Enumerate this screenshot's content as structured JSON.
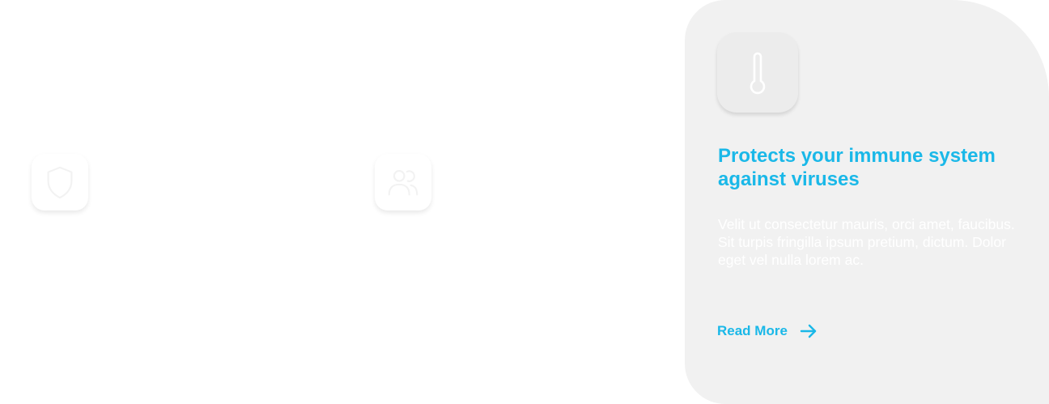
{
  "features": [
    {
      "icon": "shield-icon"
    },
    {
      "icon": "users-icon"
    }
  ],
  "active_card": {
    "icon": "thermometer-icon",
    "title": "Protects your immune system against viruses",
    "body_lines": [
      "Velit ut consectetur mauris, orci amet, faucibus.",
      "Sit turpis fringilla ipsum pretium, dictum. Dolor eget vel nulla lorem ac."
    ],
    "link_label": "Read More",
    "link_icon": "arrow-right-icon"
  },
  "colors": {
    "accent": "#1ab8e8",
    "card_background": "#f1f1f1",
    "page_background": "#ffffff"
  }
}
